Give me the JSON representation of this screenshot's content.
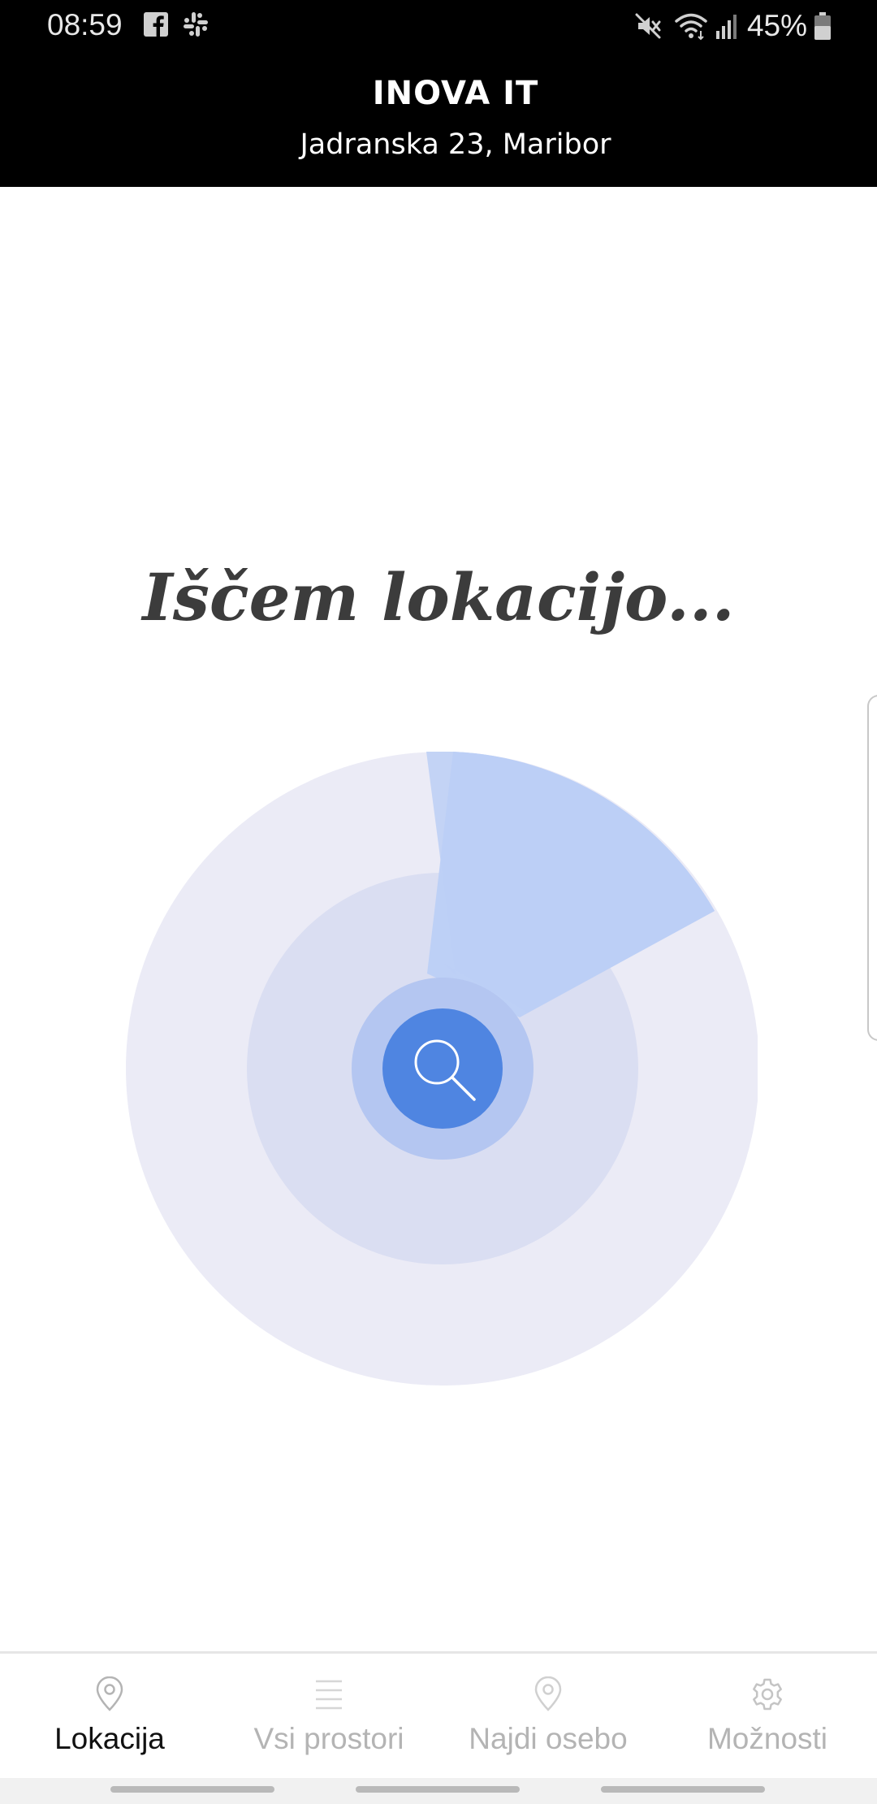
{
  "status_bar": {
    "time": "08:59",
    "battery_percent": "45%",
    "notification_icons": [
      "facebook-icon",
      "slack-icon"
    ],
    "system_icons": [
      "mute-icon",
      "wifi-icon",
      "signal-icon",
      "battery-icon"
    ]
  },
  "header": {
    "title": "INOVA IT",
    "subtitle": "Jadranska 23, Maribor"
  },
  "main": {
    "title": "Iščem lokacijo...",
    "radar_icon": "search-icon",
    "colors": {
      "outer_ring": "#ebebf6",
      "middle_ring": "#dadef2",
      "inner_ring": "#b4c6f1",
      "core": "#4f85e1",
      "sweep": "#bccff5"
    }
  },
  "bottom_nav": {
    "active_index": 0,
    "items": [
      {
        "label": "Lokacija",
        "icon": "location-pin-icon"
      },
      {
        "label": "Vsi prostori",
        "icon": "list-icon"
      },
      {
        "label": "Najdi osebo",
        "icon": "location-pin-icon"
      },
      {
        "label": "Možnosti",
        "icon": "gear-icon"
      }
    ]
  }
}
